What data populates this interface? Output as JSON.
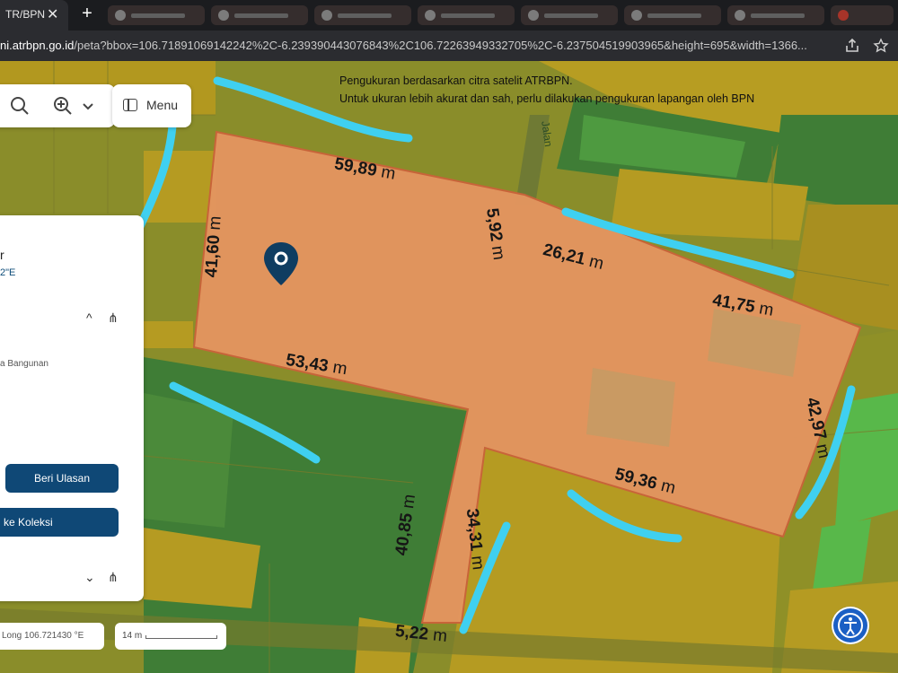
{
  "browser": {
    "active_tab": "TR/BPN",
    "tab_close": "✕",
    "new_tab": "+",
    "url_host": "ni.atrbpn.go.id",
    "url_path": "/peta?bbox=106.71891069142242%2C-6.239390443076843%2C106.72263949332705%2C-6.237504519903965&height=695&width=1366..."
  },
  "map": {
    "notice_line1": "Pengukuran berdasarkan citra satelit ATRBPN.",
    "notice_line2": "Untuk ukuran lebih akurat dan sah, perlu dilakukan pengukuran lapangan oleh BPN",
    "road_label": "Jalan",
    "menu_label": "Menu",
    "panel": {
      "title_fragment": "r",
      "coord_fragment": "2\"E",
      "chevron_up": "^",
      "share": "⋔",
      "sub_fragment": "a Bangunan",
      "review_button": "Beri Ulasan",
      "collection_button": "n ke Koleksi",
      "chevron_down": "⌄"
    },
    "coordinate_readout": "Long 106.721430 °E",
    "scale_label": "14 m",
    "measurements": [
      {
        "value": "59,89",
        "unit": "m"
      },
      {
        "value": "5,92",
        "unit": "m"
      },
      {
        "value": "26,21",
        "unit": "m"
      },
      {
        "value": "41,75",
        "unit": "m"
      },
      {
        "value": "41,60",
        "unit": "m"
      },
      {
        "value": "53,43",
        "unit": "m"
      },
      {
        "value": "42,97",
        "unit": "m"
      },
      {
        "value": "59,36",
        "unit": "m"
      },
      {
        "value": "40,85",
        "unit": "m"
      },
      {
        "value": "34,31",
        "unit": "m"
      },
      {
        "value": "5,22",
        "unit": "m"
      }
    ],
    "colors": {
      "parcel_fill": "#e3955f",
      "parcel_border": "#c9633a",
      "dark_green": "#3f7d36",
      "olive": "#8f8f23",
      "ochre": "#b69a1e",
      "light_green": "#58b84a",
      "highlight_stroke": "#3fd0f0",
      "button_blue": "#0f4876"
    },
    "icons": [
      "search-icon",
      "zoom-in-icon",
      "chevron-down-icon",
      "menu-icon",
      "location-pin-icon",
      "share-icon",
      "accessibility-icon",
      "share-page-icon",
      "bookmark-star-icon"
    ]
  }
}
